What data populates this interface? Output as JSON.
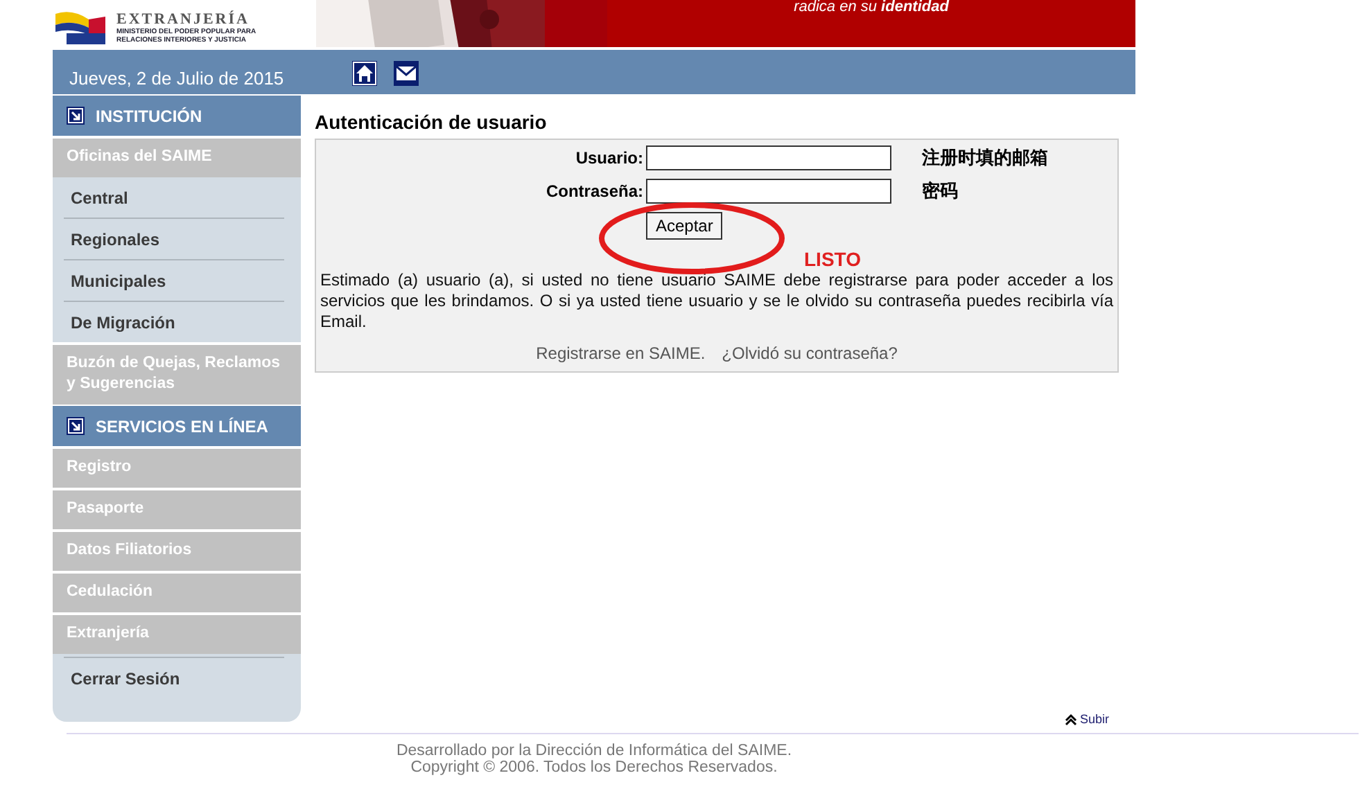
{
  "header": {
    "agency": "EXTRANJERÍA",
    "ministry": [
      "MINISTERIO DEL PODER POPULAR PARA",
      "RELACIONES INTERIORES Y JUSTICIA"
    ],
    "tagline": "radica en su **identidad**"
  },
  "date_bar": {
    "date": "Jueves, 2 de Julio de 2015"
  },
  "sidebar": {
    "items": [
      {
        "kind": "section",
        "label": "INSTITUCIÓN"
      },
      {
        "kind": "group",
        "label": "Oficinas del SAIME"
      },
      {
        "kind": "link",
        "label": "Central"
      },
      {
        "kind": "link",
        "label": "Regionales"
      },
      {
        "kind": "link",
        "label": "Municipales"
      },
      {
        "kind": "link",
        "label": "De Migración"
      },
      {
        "kind": "group",
        "label": "Buzón de Quejas, Reclamos y Sugerencias"
      },
      {
        "kind": "section",
        "label": "SERVICIOS EN LÍNEA"
      },
      {
        "kind": "group",
        "label": "Registro"
      },
      {
        "kind": "group",
        "label": "Pasaporte"
      },
      {
        "kind": "group",
        "label": "Datos Filiatorios"
      },
      {
        "kind": "group",
        "label": "Cedulación"
      },
      {
        "kind": "group",
        "label": "Extranjería"
      },
      {
        "kind": "logout",
        "label": "Cerrar Sesión"
      }
    ]
  },
  "login": {
    "title": "Autenticación de usuario",
    "fields": [
      {
        "label": "Usuario:",
        "note": "注册时填的邮箱"
      },
      {
        "label": "Contraseña:",
        "note": "密码"
      }
    ],
    "button": "Aceptar",
    "button_note": "LISTO",
    "message": "Estimado (a) usuario (a), si usted no tiene usuario SAIME debe registrarse para poder acceder a los servicios que les brindamos. O si ya usted tiene usuario y se le olvido su contraseña puedes recibirla vía Email.",
    "links": [
      "Registrarse en SAIME.",
      "¿Olvidó su contraseña?"
    ]
  },
  "subir": "Subir",
  "footer": [
    "Desarrollado por la Dirección de Informática del SAIME.",
    "Copyright © 2006. Todos los Derechos Reservados."
  ]
}
